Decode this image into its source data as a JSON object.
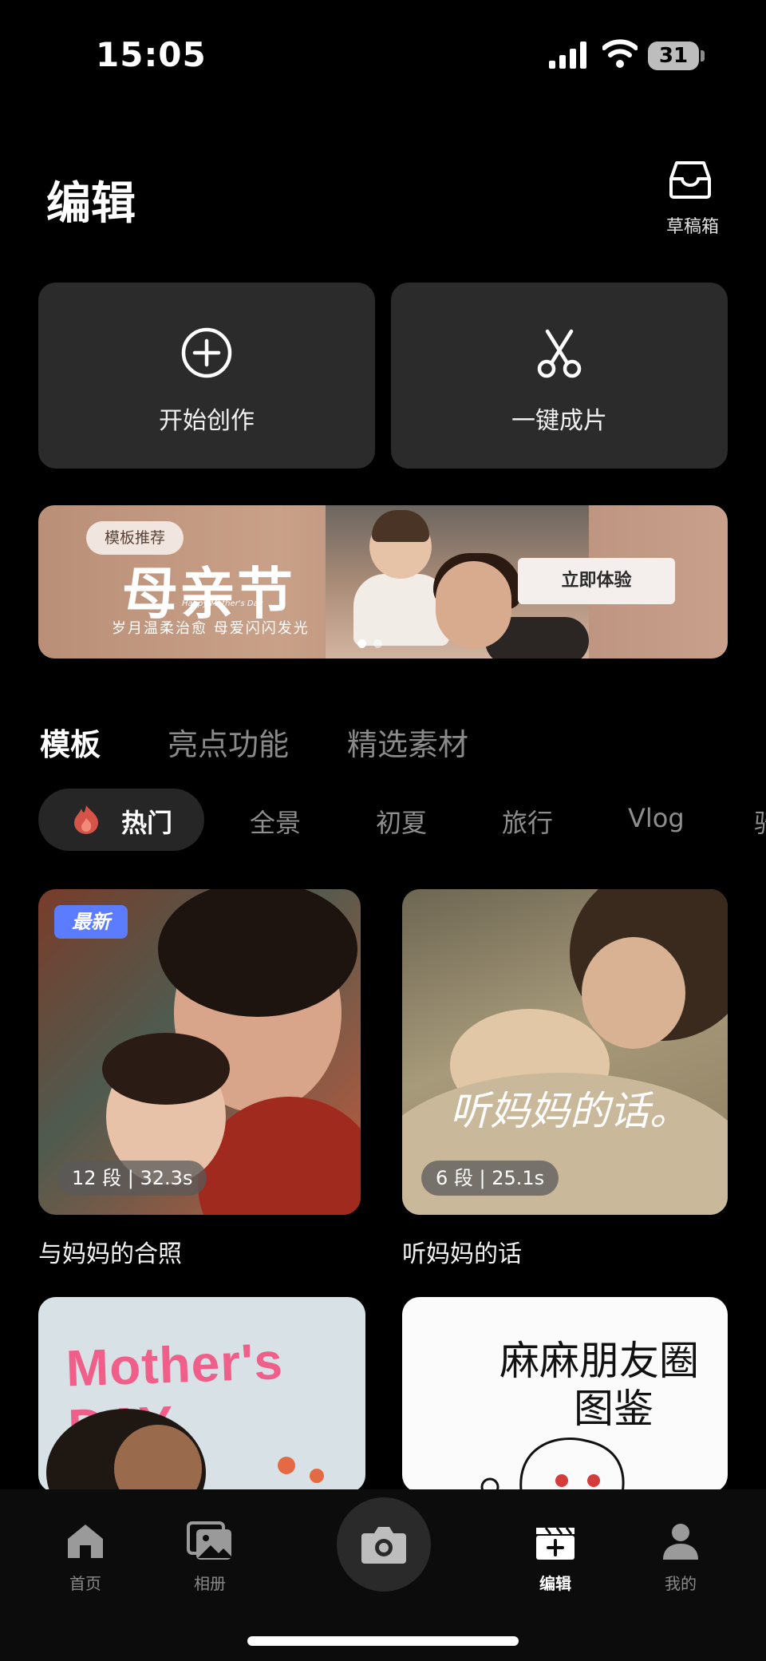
{
  "status_bar": {
    "time": "15:05",
    "battery": "31"
  },
  "header": {
    "title": "编辑",
    "drafts_label": "草稿箱"
  },
  "actions": [
    {
      "label": "开始创作",
      "icon": "plus-circle-icon"
    },
    {
      "label": "一键成片",
      "icon": "scissors-icon"
    }
  ],
  "banner": {
    "tag": "模板推荐",
    "title": "母亲节",
    "happy": "Happy Mother's Day",
    "subtitle": "岁月温柔治愈 母爱闪闪发光",
    "cta": "立即体验"
  },
  "category_tabs": [
    "模板",
    "亮点功能",
    "精选素材"
  ],
  "chips": [
    "热门",
    "全景",
    "初夏",
    "旅行",
    "Vlog",
    "骑"
  ],
  "templates": [
    {
      "badge": "最新",
      "segments": "12 段 | 32.3s",
      "title": "与妈妈的合照"
    },
    {
      "segments": "6 段 | 25.1s",
      "title": "听妈妈的话",
      "overlay": "听妈妈的话。"
    },
    {
      "overlay": "Mother's DAY"
    },
    {
      "overlay_line1": "麻麻朋友圈",
      "overlay_line2": "图鉴"
    }
  ],
  "bottom_nav": [
    "首页",
    "相册",
    "编辑",
    "我的"
  ],
  "colors": {
    "accent_blue": "#5c7cff",
    "card_bg": "#2b2b2b",
    "banner_bg": "#c9a088"
  }
}
